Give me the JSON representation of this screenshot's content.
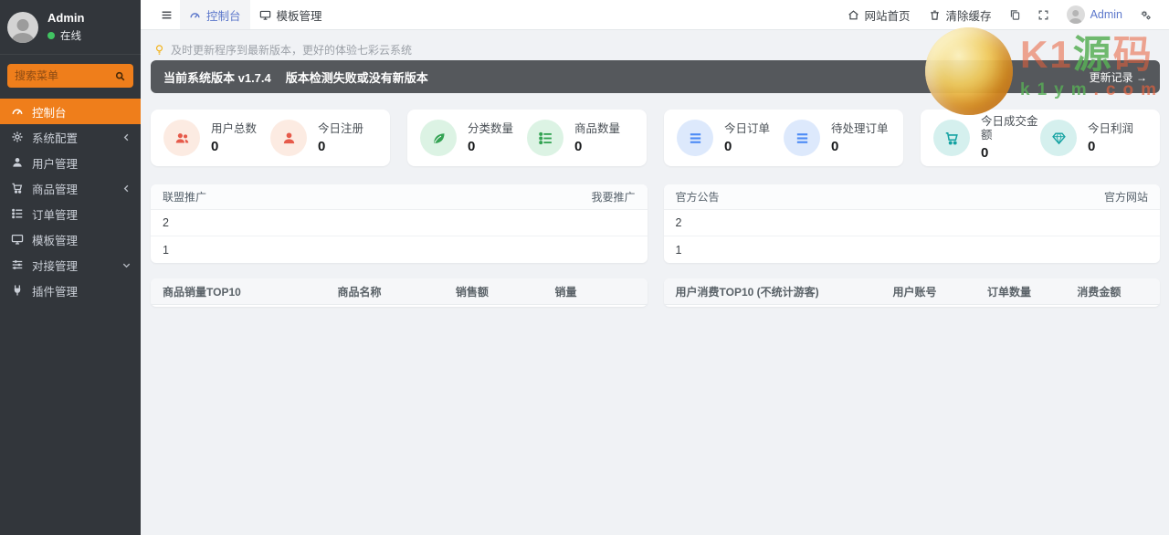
{
  "theme": {
    "accent_orange": "#ef7e1b",
    "link_blue": "#5d78cb",
    "online_green": "#41c462",
    "stat_red": "#e65a4a",
    "stat_green": "#33a353",
    "stat_blue": "#4c8bf5",
    "stat_teal": "#14a2a2",
    "banner_gray": "#55585c"
  },
  "sidebar": {
    "user": {
      "name": "Admin",
      "status": "在线"
    },
    "search_placeholder": "搜索菜单",
    "items": [
      {
        "label": "控制台",
        "icon": "tachometer-icon",
        "active": true
      },
      {
        "label": "系统配置",
        "icon": "gear-icon",
        "chevron": "left"
      },
      {
        "label": "用户管理",
        "icon": "user-icon"
      },
      {
        "label": "商品管理",
        "icon": "cart-icon",
        "chevron": "left"
      },
      {
        "label": "订单管理",
        "icon": "list-icon"
      },
      {
        "label": "模板管理",
        "icon": "desktop-icon"
      },
      {
        "label": "对接管理",
        "icon": "sliders-icon",
        "chevron": "down"
      },
      {
        "label": "插件管理",
        "icon": "plug-icon"
      }
    ]
  },
  "navbar": {
    "tabs": [
      {
        "label": "控制台",
        "active": true
      },
      {
        "label": "模板管理",
        "active": false
      }
    ],
    "right": {
      "home": "网站首页",
      "clear_cache": "清除缓存",
      "user": "Admin"
    }
  },
  "notice": {
    "text": "及时更新程序到最新版本，更好的体验七彩云系统"
  },
  "version_banner": {
    "version": "当前系统版本 v1.7.4",
    "status": "版本检测失败或没有新版本",
    "link": "更新记录 →"
  },
  "stats": [
    {
      "label": "用户总数",
      "value": "0",
      "icon": "users-icon",
      "color": "#e65a4a"
    },
    {
      "label": "今日注册",
      "value": "0",
      "icon": "user-icon",
      "color": "#e65a4a"
    },
    {
      "label": "分类数量",
      "value": "0",
      "icon": "leaf-icon",
      "color": "#33a353"
    },
    {
      "label": "商品数量",
      "value": "0",
      "icon": "list-icon",
      "color": "#33a353"
    },
    {
      "label": "今日订单",
      "value": "0",
      "icon": "list-icon",
      "color": "#4c8bf5"
    },
    {
      "label": "待处理订单",
      "value": "0",
      "icon": "list-icon",
      "color": "#4c8bf5"
    },
    {
      "label": "今日成交金额",
      "value": "0",
      "icon": "cart-icon",
      "color": "#14a2a2"
    },
    {
      "label": "今日利润",
      "value": "0",
      "icon": "gem-icon",
      "color": "#14a2a2"
    }
  ],
  "panels": [
    {
      "title": "联盟推广",
      "action": "我要推广",
      "rows": [
        "2",
        "1"
      ]
    },
    {
      "title": "官方公告",
      "action": "官方网站",
      "rows": [
        "2",
        "1"
      ]
    }
  ],
  "tables": [
    {
      "title": "商品销量TOP10",
      "columns": [
        "商品名称",
        "销售额",
        "销量"
      ]
    },
    {
      "title": "用户消费TOP10 (不统计游客)",
      "columns": [
        "用户账号",
        "订单数量",
        "消费金额"
      ]
    }
  ],
  "watermark": {
    "part1": "K1",
    "part2": "源",
    "part3": "码",
    "url1": "k1ym",
    "url2": ".com"
  }
}
